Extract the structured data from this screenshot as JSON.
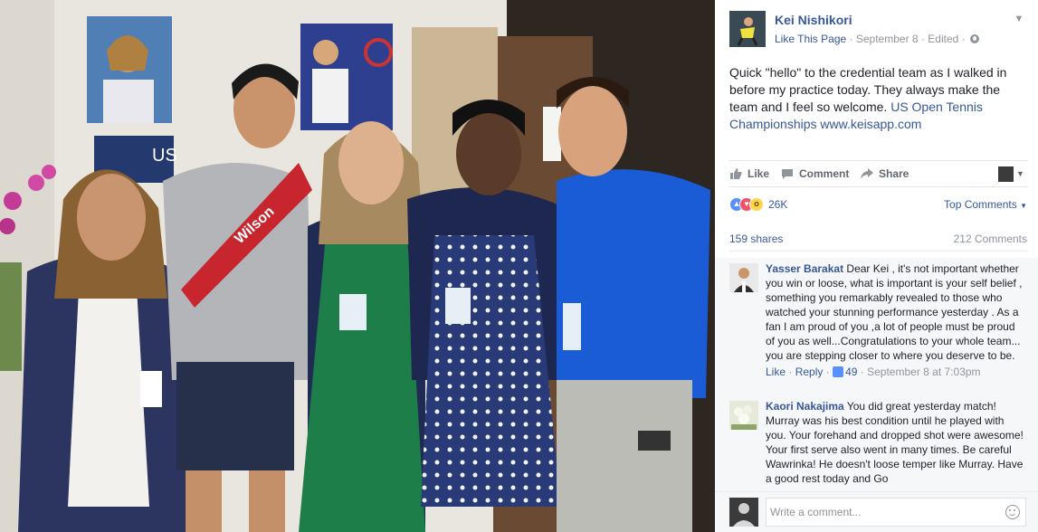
{
  "post": {
    "page_name": "Kei Nishikori",
    "like_page": "Like This Page",
    "separator": "·",
    "date": "September 8",
    "edited": "Edited",
    "text": "Quick \"hello\" to the credential team as I walked in before my practice today. They always make the team and I feel so welcome.",
    "tag_text": "US Open Tennis Championships",
    "link_text": "www.keisapp.com"
  },
  "actions": {
    "like": "Like",
    "comment": "Comment",
    "share": "Share"
  },
  "reactions": {
    "count": "26K",
    "sort": "Top Comments"
  },
  "counts": {
    "shares": "159 shares",
    "comments": "212 Comments"
  },
  "comments": [
    {
      "author": "Yasser Barakat",
      "text": "Dear Kei , it's not important whether you win or loose, what is important is your self belief , something you remarkably revealed to those who watched your stunning performance yesterday . As a fan I am proud of you ,a lot of people must be proud of you as well...Congratulations to your whole team... you are stepping closer to where you deserve to be.",
      "like": "Like",
      "reply": "Reply",
      "likes": "49",
      "time": "September 8 at 7:03pm"
    },
    {
      "author": "Kaori Nakajima",
      "text": "You did great yesterday match! Murray was his best condition until he played with you. Your forehand and dropped shot were awesome! Your first serve also went in many times. Be careful Wawrinka! He doesn't loose temper like Murray. Have a good rest today and Go"
    }
  ],
  "composer": {
    "placeholder": "Write a comment..."
  },
  "colors": {
    "link": "#365899",
    "muted": "#90949c",
    "like_blue": "#5890ff",
    "love_red": "#f25268",
    "wow_yellow": "#fcd64a",
    "panel_bg": "#ffffff",
    "comments_bg": "#f6f7f9"
  },
  "photo": {
    "poster_text": "US",
    "bag_text": "Wilson"
  }
}
